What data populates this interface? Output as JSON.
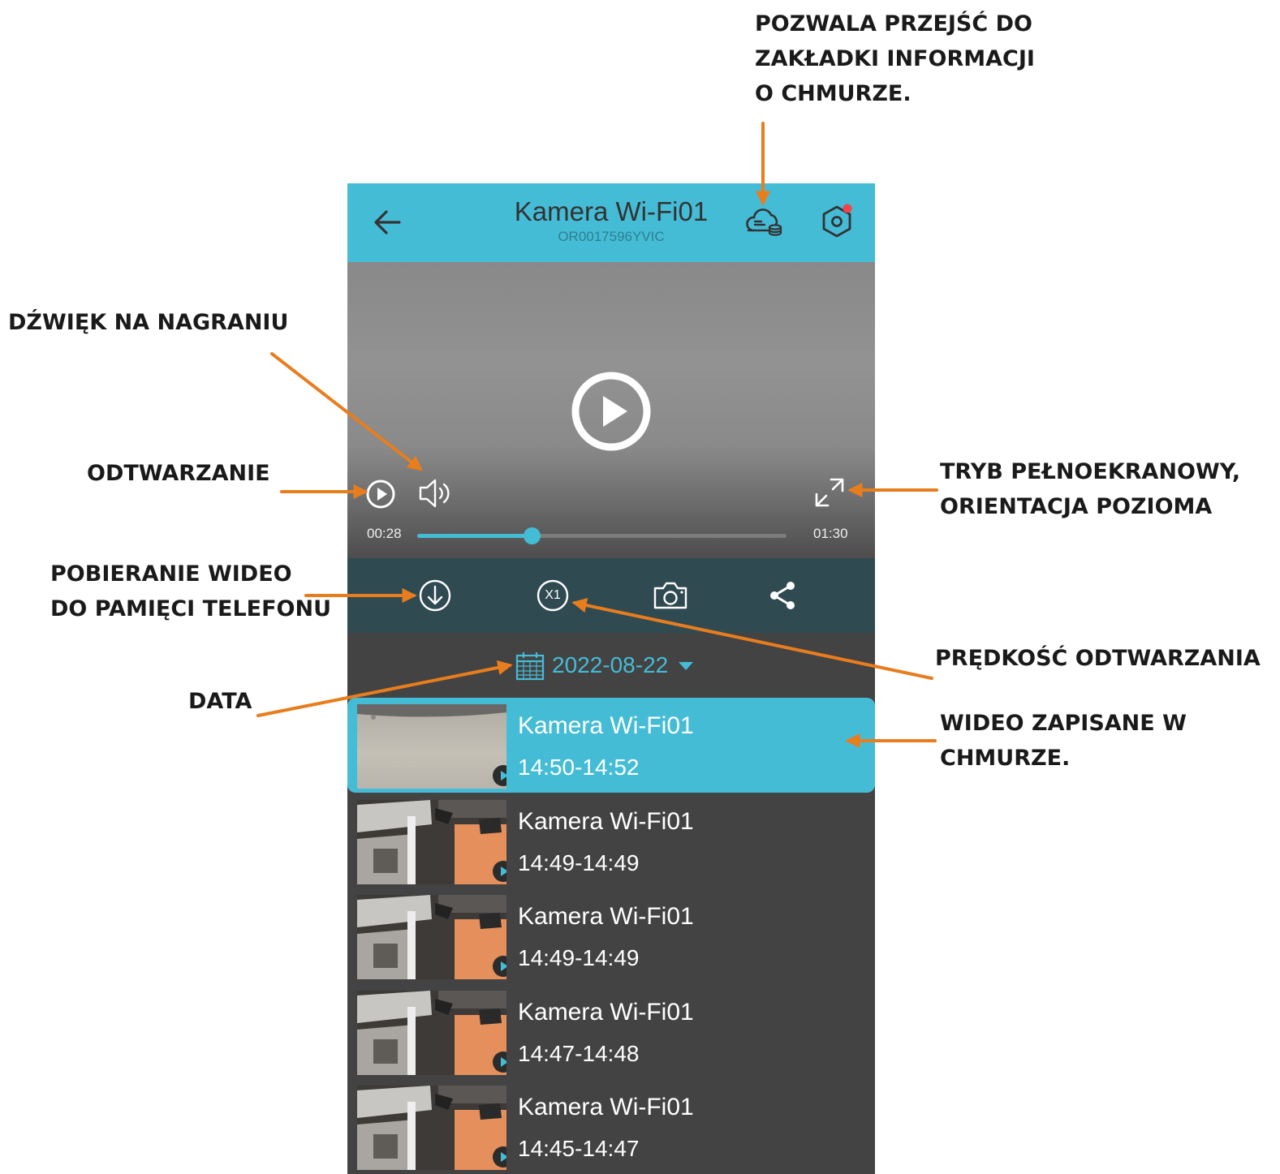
{
  "annotations": {
    "cloud_info": [
      "POZWALA PRZEJŚĆ DO",
      "ZAKŁADKI INFORMACJI",
      "O CHMURZE."
    ],
    "sound": "DŹWIĘK NA NAGRANIU",
    "playback": "ODTWARZANIE",
    "fullscreen": [
      "TRYB PEŁNOEKRANOWY,",
      "ORIENTACJA POZIOMA"
    ],
    "download": [
      "POBIERANIE WIDEO",
      "DO PAMIĘCI TELEFONU"
    ],
    "speed": "PRĘDKOŚĆ ODTWARZANIA",
    "date": "DATA",
    "cloud_videos": [
      "WIDEO ZAPISANE W",
      "CHMURZE."
    ]
  },
  "header": {
    "title": "Kamera Wi-Fi01",
    "serial": "OR0017596YVIC",
    "back_icon": "arrow-left-icon",
    "cloud_icon": "cloud-storage-icon",
    "settings_icon": "hexagon-settings-icon",
    "notification_dot": true
  },
  "player": {
    "current_time": "00:28",
    "total_time": "01:30",
    "progress": 0.31
  },
  "toolbar": {
    "download_icon": "download-icon",
    "speed_label": "X1",
    "snapshot_icon": "camera-icon",
    "share_icon": "share-icon"
  },
  "date_filter": {
    "date": "2022-08-22"
  },
  "recordings": [
    {
      "name": "Kamera Wi-Fi01",
      "time": "14:50-14:52",
      "selected": true
    },
    {
      "name": "Kamera Wi-Fi01",
      "time": "14:49-14:49",
      "selected": false
    },
    {
      "name": "Kamera Wi-Fi01",
      "time": "14:49-14:49",
      "selected": false
    },
    {
      "name": "Kamera Wi-Fi01",
      "time": "14:47-14:48",
      "selected": false
    },
    {
      "name": "Kamera Wi-Fi01",
      "time": "14:45-14:47",
      "selected": false
    }
  ],
  "colors": {
    "accent": "#45bcd6",
    "toolbar": "#304a52",
    "list_background": "#434343",
    "arrow": "#e87d1e"
  }
}
